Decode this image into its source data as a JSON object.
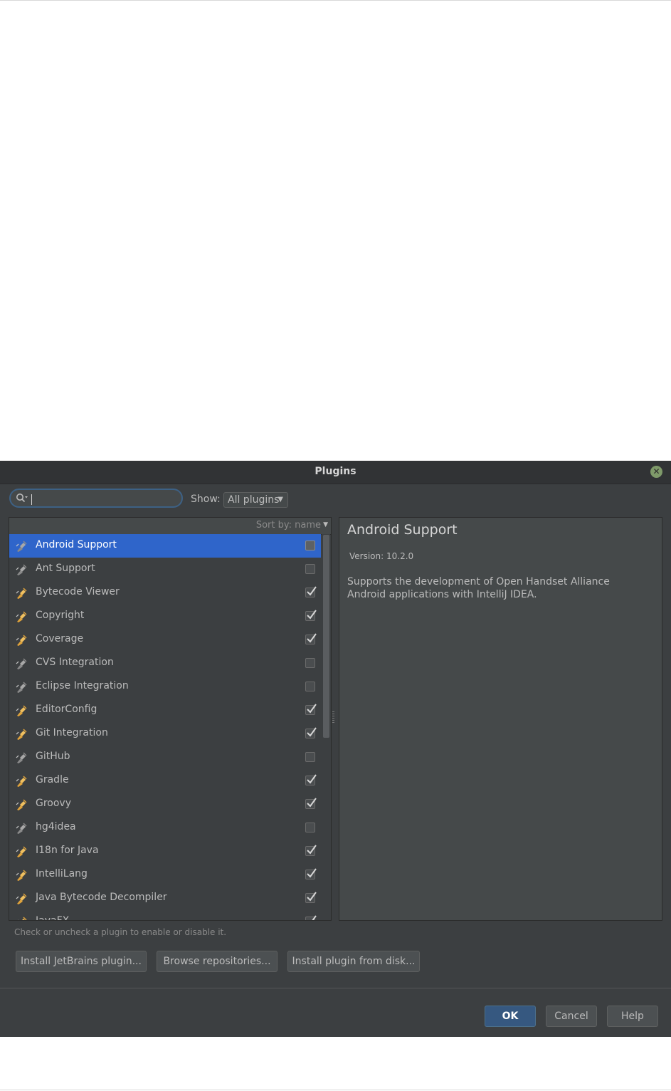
{
  "dialog": {
    "title": "Plugins",
    "search": {
      "value": "",
      "placeholder": ""
    },
    "show_label": "Show:",
    "show_value": "All plugins",
    "sort_label": "Sort by: name",
    "plugins": [
      {
        "name": "Android Support",
        "checked": false,
        "selected": true
      },
      {
        "name": "Ant Support",
        "checked": false
      },
      {
        "name": "Bytecode Viewer",
        "checked": true
      },
      {
        "name": "Copyright",
        "checked": true
      },
      {
        "name": "Coverage",
        "checked": true
      },
      {
        "name": "CVS Integration",
        "checked": false
      },
      {
        "name": "Eclipse Integration",
        "checked": false
      },
      {
        "name": "EditorConfig",
        "checked": true
      },
      {
        "name": "Git Integration",
        "checked": true
      },
      {
        "name": "GitHub",
        "checked": false
      },
      {
        "name": "Gradle",
        "checked": true
      },
      {
        "name": "Groovy",
        "checked": true
      },
      {
        "name": "hg4idea",
        "checked": false
      },
      {
        "name": "I18n for Java",
        "checked": true
      },
      {
        "name": "IntelliLang",
        "checked": true
      },
      {
        "name": "Java Bytecode Decompiler",
        "checked": true
      },
      {
        "name": "JavaFX",
        "checked": true
      }
    ],
    "detail": {
      "title": "Android Support",
      "version": "Version: 10.2.0",
      "description": "Supports the development of Open Handset Alliance Android applications with IntelliJ IDEA."
    },
    "hint": "Check or uncheck a plugin to enable or disable it.",
    "buttons": {
      "install_jetbrains": "Install JetBrains plugin...",
      "browse_repos": "Browse repositories...",
      "install_disk": "Install plugin from disk...",
      "ok": "OK",
      "cancel": "Cancel",
      "help": "Help"
    },
    "colors": {
      "selection": "#2f65ca",
      "enabled_icon": "#e0a33b",
      "disabled_icon": "#8a8a8a",
      "ok_button": "#365880"
    }
  }
}
